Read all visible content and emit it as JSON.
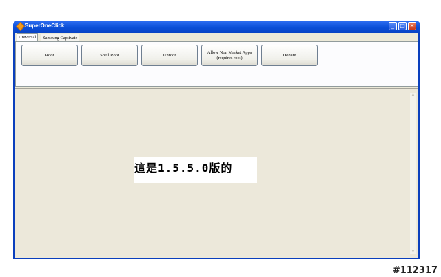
{
  "window": {
    "title": "SuperOneClick"
  },
  "tabs": [
    {
      "label": "Universal",
      "active": true
    },
    {
      "label": "Samsung Captivate",
      "active": false
    }
  ],
  "buttons": {
    "root": "Root",
    "shell_root": "Shell Root",
    "unroot": "Unroot",
    "allow_non_market_line1": "Allow Non Market Apps",
    "allow_non_market_line2": "(requires root)",
    "donate": "Donate"
  },
  "caption": "這是1.5.5.0版的",
  "watermark": "#112317",
  "colors": {
    "title_bar": "#0b4fd8",
    "client_bg": "#ece9d8",
    "close_button": "#c8381a"
  }
}
